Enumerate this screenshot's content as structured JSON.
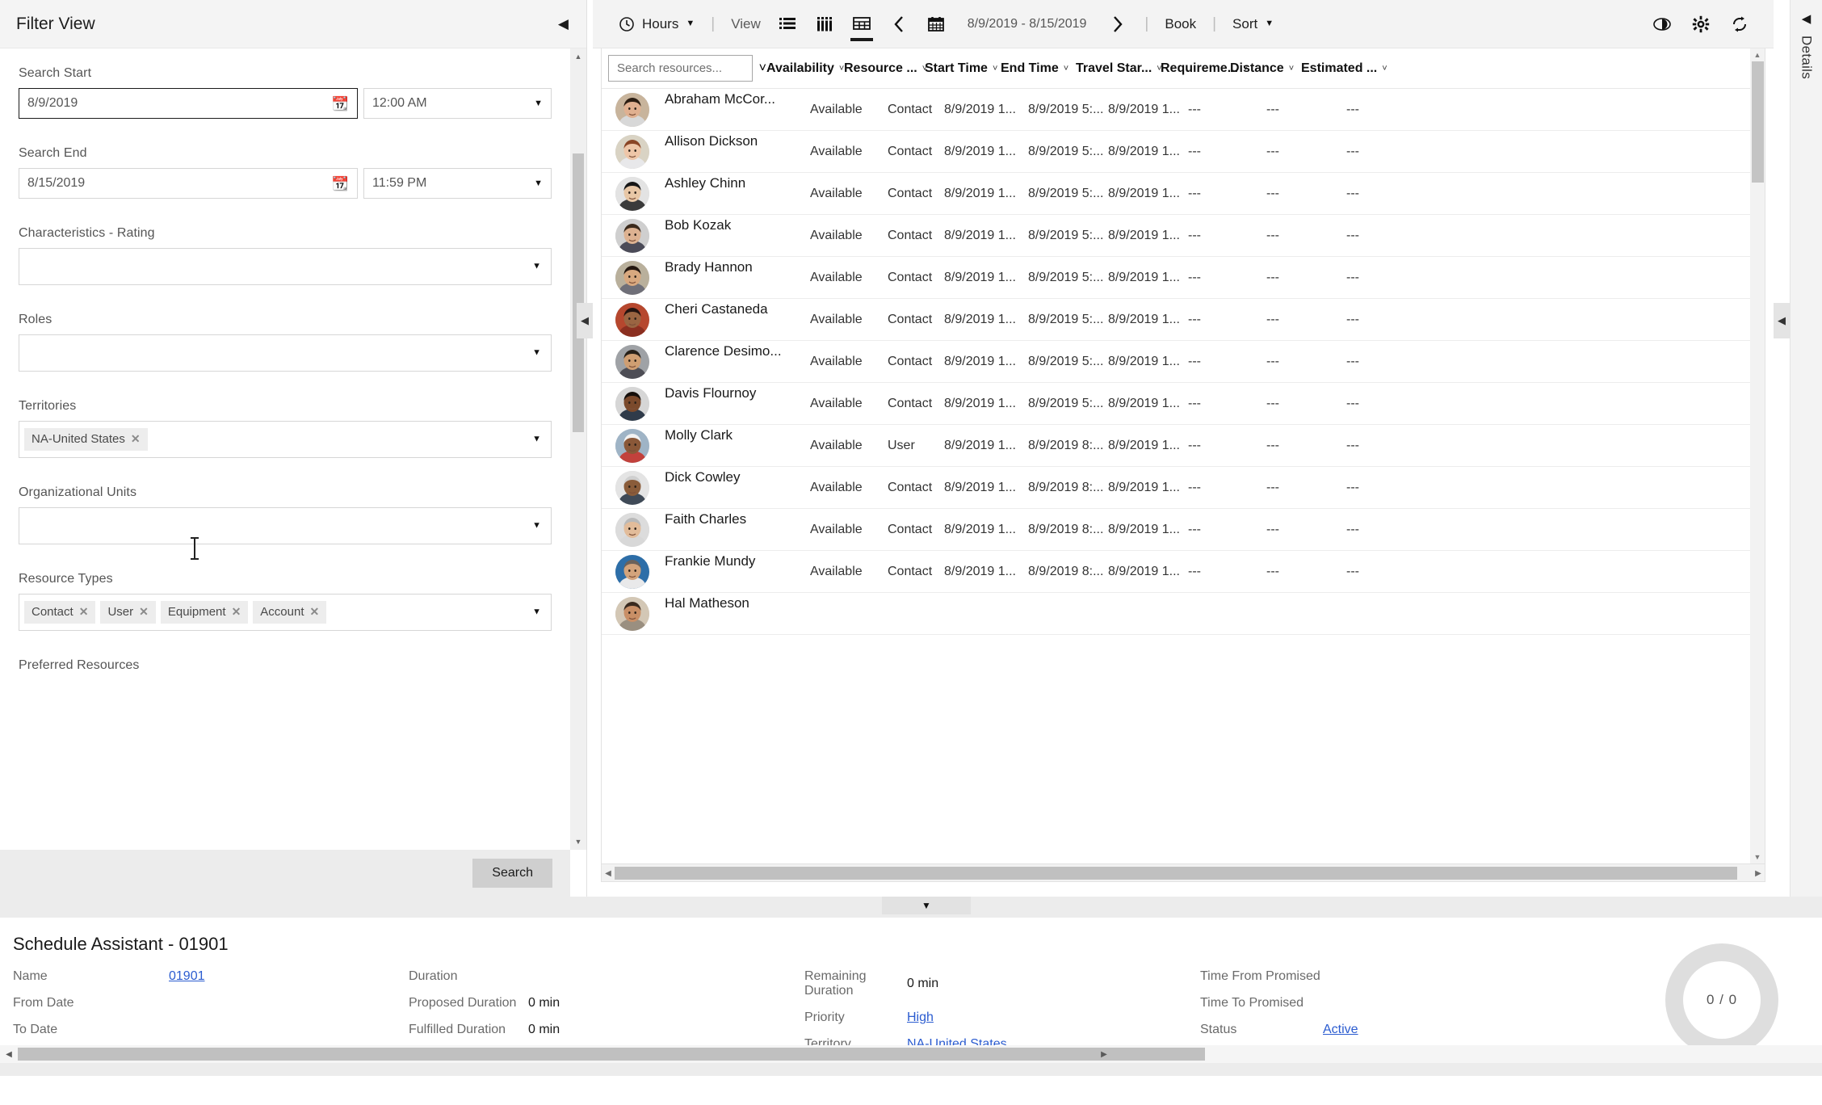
{
  "filter": {
    "title": "Filter View",
    "collapse_icon": "chevron-left-icon",
    "search_start": {
      "label": "Search Start",
      "date": "8/9/2019",
      "time": "12:00 AM",
      "calendar_icon": "calendar-icon"
    },
    "search_end": {
      "label": "Search End",
      "date": "8/15/2019",
      "time": "11:59 PM",
      "calendar_icon": "calendar-icon"
    },
    "characteristics_rating": {
      "label": "Characteristics - Rating",
      "values": []
    },
    "roles": {
      "label": "Roles",
      "values": []
    },
    "territories": {
      "label": "Territories",
      "values": [
        "NA-United States"
      ]
    },
    "organizational_units": {
      "label": "Organizational Units",
      "values": []
    },
    "resource_types": {
      "label": "Resource Types",
      "values": [
        "Contact",
        "User",
        "Equipment",
        "Account"
      ]
    },
    "preferred_resources": {
      "label": "Preferred Resources"
    },
    "search_button": "Search"
  },
  "toolbar": {
    "hours_label": "Hours",
    "hours_icon": "clock-icon",
    "hours_caret": "caret-down-icon",
    "view_label": "View",
    "view_icons": [
      "list-view-icon",
      "column-view-icon",
      "grid-view-icon"
    ],
    "active_view_index": 2,
    "prev_icon": "chevron-left-icon",
    "calendar_icon": "calendar-icon",
    "date_range": "8/9/2019 - 8/15/2019",
    "next_icon": "chevron-right-icon",
    "book_label": "Book",
    "sort_label": "Sort",
    "sort_caret": "caret-down-icon",
    "right_icons": [
      "eye-icon",
      "gear-icon",
      "refresh-icon"
    ],
    "separator": "|"
  },
  "details_tab": {
    "label": "Details",
    "collapse_icon": "chevron-left-icon"
  },
  "table": {
    "search_placeholder": "Search resources...",
    "columns": [
      {
        "label": "",
        "sort_icon": "chevron-down-icon"
      },
      {
        "label": "Availability",
        "sort_icon": "chevron-down-icon"
      },
      {
        "label": "Resource ...",
        "sort_icon": "chevron-down-icon"
      },
      {
        "label": "Start Time",
        "sort_icon": "chevron-down-icon"
      },
      {
        "label": "End Time",
        "sort_icon": "chevron-down-icon"
      },
      {
        "label": "Travel Star...",
        "sort_icon": "chevron-down-icon"
      },
      {
        "label": "Requireme...",
        "sort_icon": "chevron-down-icon"
      },
      {
        "label": "Distance",
        "sort_icon": "chevron-down-icon"
      },
      {
        "label": "Estimated ...",
        "sort_icon": "chevron-down-icon"
      }
    ],
    "rows": [
      {
        "name": "Abraham McCor...",
        "availability": "Available",
        "type": "Contact",
        "start": "8/9/2019 1...",
        "end": "8/9/2019 5:...",
        "travel": "8/9/2019 1...",
        "requirement": "---",
        "distance": "---",
        "estimated": "---",
        "avatar": "male-young-1"
      },
      {
        "name": "Allison Dickson",
        "availability": "Available",
        "type": "Contact",
        "start": "8/9/2019 1...",
        "end": "8/9/2019 5:...",
        "travel": "8/9/2019 1...",
        "requirement": "---",
        "distance": "---",
        "estimated": "---",
        "avatar": "female-redhead"
      },
      {
        "name": "Ashley Chinn",
        "availability": "Available",
        "type": "Contact",
        "start": "8/9/2019 1...",
        "end": "8/9/2019 5:...",
        "travel": "8/9/2019 1...",
        "requirement": "---",
        "distance": "---",
        "estimated": "---",
        "avatar": "female-asian"
      },
      {
        "name": "Bob Kozak",
        "availability": "Available",
        "type": "Contact",
        "start": "8/9/2019 1...",
        "end": "8/9/2019 5:...",
        "travel": "8/9/2019 1...",
        "requirement": "---",
        "distance": "---",
        "estimated": "---",
        "avatar": "male-beard"
      },
      {
        "name": "Brady Hannon",
        "availability": "Available",
        "type": "Contact",
        "start": "8/9/2019 1...",
        "end": "8/9/2019 5:...",
        "travel": "8/9/2019 1...",
        "requirement": "---",
        "distance": "---",
        "estimated": "---",
        "avatar": "male-smiling"
      },
      {
        "name": "Cheri Castaneda",
        "availability": "Available",
        "type": "Contact",
        "start": "8/9/2019 1...",
        "end": "8/9/2019 5:...",
        "travel": "8/9/2019 1...",
        "requirement": "---",
        "distance": "---",
        "estimated": "---",
        "avatar": "female-dark"
      },
      {
        "name": "Clarence Desimo...",
        "availability": "Available",
        "type": "Contact",
        "start": "8/9/2019 1...",
        "end": "8/9/2019 5:...",
        "travel": "8/9/2019 1...",
        "requirement": "---",
        "distance": "---",
        "estimated": "---",
        "avatar": "male-glasses"
      },
      {
        "name": "Davis Flournoy",
        "availability": "Available",
        "type": "Contact",
        "start": "8/9/2019 1...",
        "end": "8/9/2019 5:...",
        "travel": "8/9/2019 1...",
        "requirement": "---",
        "distance": "---",
        "estimated": "---",
        "avatar": "male-dark"
      },
      {
        "name": "Molly Clark",
        "availability": "Available",
        "type": "User",
        "start": "8/9/2019 1...",
        "end": "8/9/2019 8:...",
        "travel": "8/9/2019 1...",
        "requirement": "---",
        "distance": "---",
        "estimated": "---",
        "avatar": "female-helmet"
      },
      {
        "name": "Dick Cowley",
        "availability": "Available",
        "type": "Contact",
        "start": "8/9/2019 1...",
        "end": "8/9/2019 8:...",
        "travel": "8/9/2019 1...",
        "requirement": "---",
        "distance": "---",
        "estimated": "---",
        "avatar": "male-gray"
      },
      {
        "name": "Faith Charles",
        "availability": "Available",
        "type": "Contact",
        "start": "8/9/2019 1...",
        "end": "8/9/2019 8:...",
        "travel": "8/9/2019 1...",
        "requirement": "---",
        "distance": "---",
        "estimated": "---",
        "avatar": "female-gray"
      },
      {
        "name": "Frankie Mundy",
        "availability": "Available",
        "type": "Contact",
        "start": "8/9/2019 1...",
        "end": "8/9/2019 8:...",
        "travel": "8/9/2019 1...",
        "requirement": "---",
        "distance": "---",
        "estimated": "---",
        "avatar": "male-glasses-2"
      },
      {
        "name": "Hal Matheson",
        "availability": "",
        "type": "",
        "start": "",
        "end": "",
        "travel": "",
        "requirement": "",
        "distance": "",
        "estimated": "",
        "avatar": "female-long"
      }
    ]
  },
  "bottom": {
    "title": "Schedule Assistant - 01901",
    "fields": [
      {
        "key": "Name",
        "value": "01901",
        "link": true
      },
      {
        "key": "From Date",
        "value": "",
        "link": false
      },
      {
        "key": "To Date",
        "value": "",
        "link": false
      },
      {
        "key": "Duration",
        "value": "",
        "link": false
      },
      {
        "key": "Proposed Duration",
        "value": "0 min",
        "link": false
      },
      {
        "key": "Fulfilled Duration",
        "value": "0 min",
        "link": false
      },
      {
        "key": "Remaining Duration",
        "value": "0 min",
        "link": false
      },
      {
        "key": "Priority",
        "value": "High",
        "link": true
      },
      {
        "key": "Territory",
        "value": "NA-United States",
        "link": true
      },
      {
        "key": "Time From Promised",
        "value": "",
        "link": false
      },
      {
        "key": "Time To Promised",
        "value": "",
        "link": false
      },
      {
        "key": "Status",
        "value": "Active",
        "link": true
      }
    ],
    "donut": "0 / 0"
  },
  "colors": {
    "accent_link": "#2b5cd0",
    "panel_bg": "#f3f3f3",
    "chip_bg": "#ededed",
    "scroll_thumb": "#c4c4c4"
  }
}
